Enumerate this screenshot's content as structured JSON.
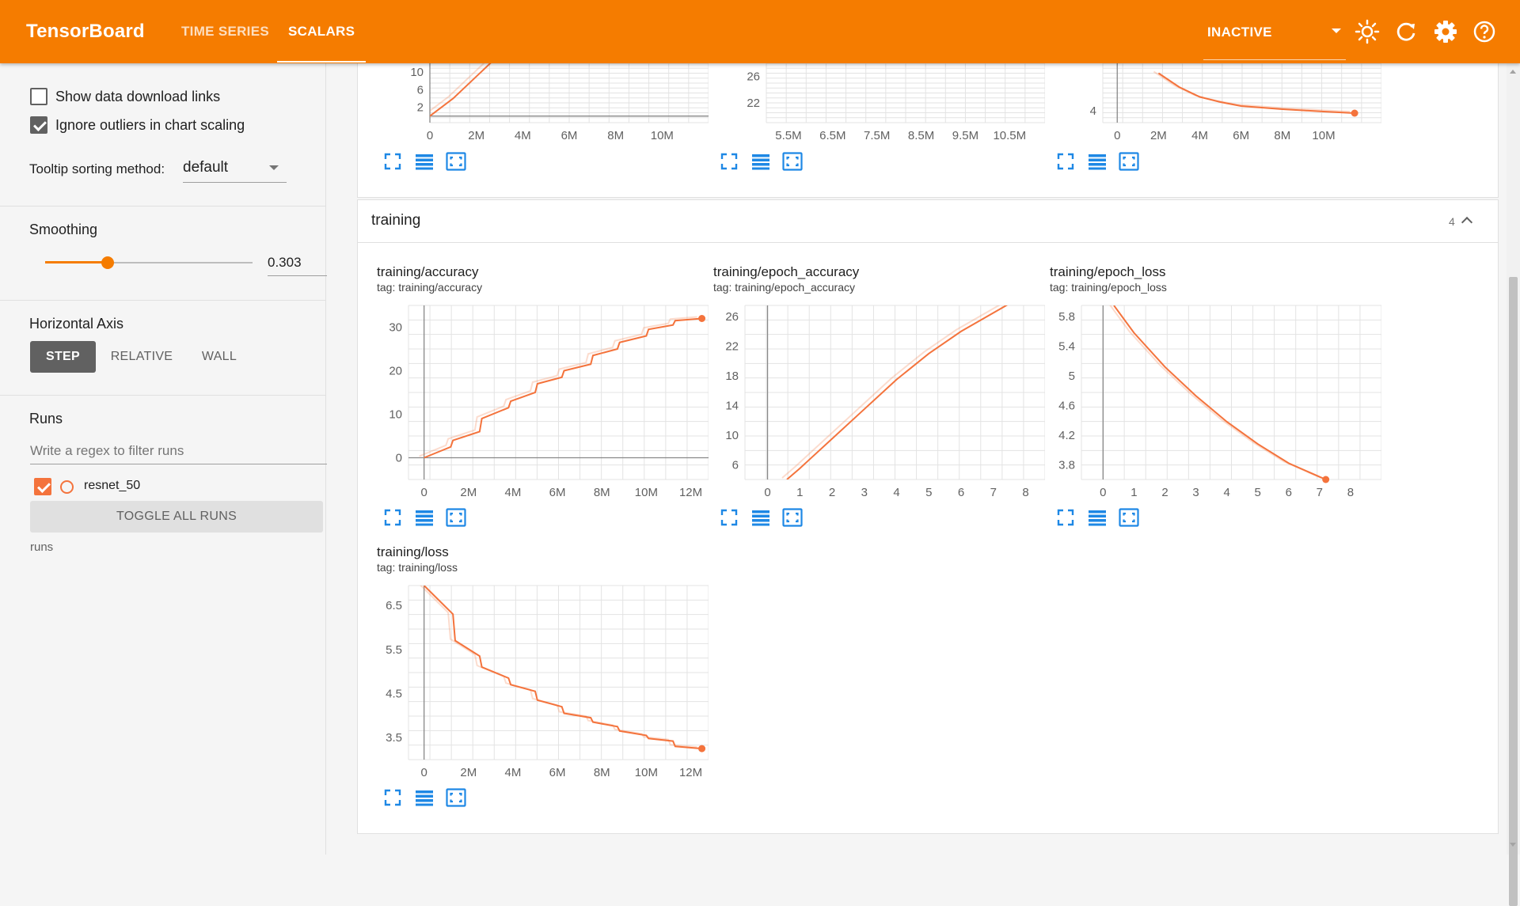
{
  "header": {
    "brand": "TensorBoard",
    "tabs": [
      {
        "label": "TIME SERIES",
        "active": false
      },
      {
        "label": "SCALARS",
        "active": true
      }
    ],
    "status_select": "INACTIVE",
    "icons": [
      "caret-down-icon",
      "brightness-icon",
      "refresh-icon",
      "settings-icon",
      "help-icon"
    ],
    "color": "#f57c00"
  },
  "sidebar": {
    "show_download_links": {
      "label": "Show data download links",
      "checked": false
    },
    "ignore_outliers": {
      "label": "Ignore outliers in chart scaling",
      "checked": true
    },
    "tooltip_sorting": {
      "label": "Tooltip sorting method:",
      "value": "default"
    },
    "smoothing": {
      "label": "Smoothing",
      "value": "0.303",
      "fraction": 0.303
    },
    "horizontal_axis": {
      "label": "Horizontal Axis",
      "options": [
        "STEP",
        "RELATIVE",
        "WALL"
      ],
      "selected": "STEP"
    },
    "runs": {
      "label": "Runs",
      "filter_placeholder": "Write a regex to filter runs",
      "items": [
        {
          "name": "resnet_50",
          "checked": true,
          "color": "#f4733c"
        }
      ],
      "toggle_all": "TOGGLE ALL RUNS",
      "footer": "runs"
    }
  },
  "main": {
    "group": {
      "name": "training",
      "count": "4"
    },
    "run_color": "#f4733c"
  },
  "chart_data": [
    {
      "type": "line",
      "title": "",
      "x_ticks": [
        "0",
        "2M",
        "4M",
        "6M",
        "8M",
        "10M"
      ],
      "y_ticks": [
        "2",
        "6",
        "10"
      ],
      "xlim": [
        0,
        12000000
      ],
      "series": [
        {
          "x": [
            0,
            1000000,
            2000000,
            3000000,
            3500000
          ],
          "y": [
            0,
            4,
            9,
            14,
            17
          ]
        }
      ]
    },
    {
      "type": "line",
      "title": "",
      "x_ticks": [
        "5.5M",
        "6.5M",
        "7.5M",
        "8.5M",
        "9.5M",
        "10.5M"
      ],
      "y_ticks": [
        "22",
        "26"
      ],
      "series": []
    },
    {
      "type": "line",
      "title": "",
      "x_ticks": [
        "0",
        "2M",
        "4M",
        "6M",
        "8M",
        "10M"
      ],
      "y_ticks": [
        "4"
      ],
      "series": [
        {
          "x": [
            2000000,
            3000000,
            4000000,
            5000000,
            6000000,
            8000000,
            10000000,
            11500000
          ],
          "y": [
            4.95,
            4.6,
            4.35,
            4.22,
            4.12,
            4.04,
            3.98,
            3.94
          ]
        }
      ]
    },
    {
      "type": "line",
      "title": "training/accuracy",
      "tag": "tag: training/accuracy",
      "x_ticks": [
        "0",
        "2M",
        "4M",
        "6M",
        "8M",
        "10M",
        "12M"
      ],
      "y_ticks": [
        "0",
        "10",
        "20",
        "30"
      ],
      "xlim": [
        -700000,
        12800000
      ],
      "ylim": [
        -5,
        35
      ],
      "series": [
        {
          "x": [
            0,
            1200000,
            1300000,
            2500000,
            2600000,
            3800000,
            3900000,
            5000000,
            5100000,
            6200000,
            6300000,
            7500000,
            7600000,
            8700000,
            8800000,
            10000000,
            10100000,
            11200000,
            11300000,
            12500000
          ],
          "y": [
            0,
            2.5,
            4,
            6,
            9,
            11.5,
            13,
            15,
            17,
            18.5,
            20,
            21.5,
            23.5,
            25,
            26.5,
            28,
            29.5,
            30.5,
            31.5,
            32
          ]
        }
      ]
    },
    {
      "type": "line",
      "title": "training/epoch_accuracy",
      "tag": "tag: training/epoch_accuracy",
      "x_ticks": [
        "0",
        "1",
        "2",
        "3",
        "4",
        "5",
        "6",
        "7",
        "8"
      ],
      "y_ticks": [
        "6",
        "10",
        "14",
        "18",
        "22",
        "26"
      ],
      "xlim": [
        -0.7,
        8.6
      ],
      "ylim": [
        4,
        27.5
      ],
      "series": [
        {
          "x": [
            0.6,
            1,
            2,
            3,
            4,
            5,
            6,
            7,
            7.6
          ],
          "y": [
            4,
            5.5,
            9.5,
            13.5,
            17.5,
            21,
            24,
            26.5,
            28
          ]
        }
      ]
    },
    {
      "type": "line",
      "title": "training/epoch_loss",
      "tag": "tag: training/epoch_loss",
      "x_ticks": [
        "0",
        "1",
        "2",
        "3",
        "4",
        "5",
        "6",
        "7",
        "8"
      ],
      "y_ticks": [
        "3.8",
        "4.2",
        "4.6",
        "5",
        "5.4",
        "5.8"
      ],
      "xlim": [
        -0.7,
        9
      ],
      "ylim": [
        3.6,
        5.95
      ],
      "series": [
        {
          "x": [
            0.35,
            1,
            2,
            3,
            4,
            5,
            6,
            7.2
          ],
          "y": [
            5.95,
            5.58,
            5.12,
            4.73,
            4.38,
            4.08,
            3.82,
            3.6
          ]
        }
      ]
    },
    {
      "type": "line",
      "title": "training/loss",
      "tag": "tag: training/loss",
      "x_ticks": [
        "0",
        "2M",
        "4M",
        "6M",
        "8M",
        "10M",
        "12M"
      ],
      "y_ticks": [
        "3.5",
        "4.5",
        "5.5",
        "6.5"
      ],
      "xlim": [
        -700000,
        12800000
      ],
      "ylim": [
        3.0,
        6.95
      ],
      "series": [
        {
          "x": [
            0,
            1300000,
            1400000,
            2500000,
            2600000,
            3800000,
            3900000,
            5000000,
            5100000,
            6200000,
            6300000,
            7500000,
            7600000,
            8700000,
            8800000,
            10000000,
            10100000,
            11200000,
            11300000,
            12500000
          ],
          "y": [
            6.95,
            6.3,
            5.7,
            5.35,
            5.1,
            4.85,
            4.7,
            4.55,
            4.35,
            4.2,
            4.05,
            3.95,
            3.85,
            3.75,
            3.65,
            3.55,
            3.48,
            3.42,
            3.3,
            3.25
          ]
        }
      ]
    }
  ]
}
